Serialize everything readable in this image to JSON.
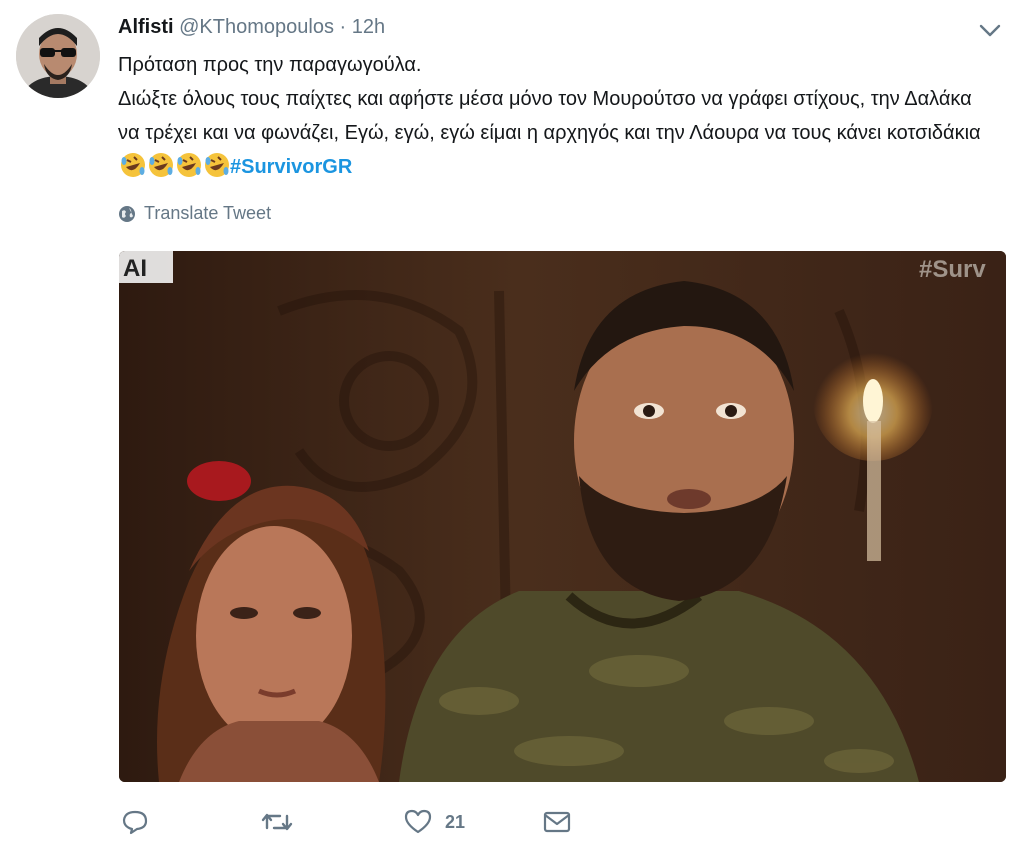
{
  "tweet": {
    "display_name": "Alfisti",
    "handle": "@KThomopoulos",
    "separator": "·",
    "time": "12h",
    "line1": "Πρόταση προς την παραγωγούλα.",
    "line2": "Διώξτε όλους τους παίχτες και αφήστε μέσα μόνο τον Μουρούτσο να γράφει στίχους, την Δαλάκα να τρέχει και να φωνάζει, Εγώ, εγώ, εγώ είμαι η αρχηγός και την Λάουρα να τους κάνει κοτσιδάκια",
    "emoji": [
      "rofl-emoji",
      "rofl-emoji",
      "rofl-emoji",
      "rofl-emoji"
    ],
    "hashtag": "#SurvivorGR",
    "translate_label": "Translate Tweet"
  },
  "media": {
    "channel_logo": "AI",
    "watermark": "#Surv"
  },
  "actions": {
    "reply_icon": "reply-icon",
    "retweet_icon": "retweet-icon",
    "like_icon": "heart-icon",
    "like_count": "21",
    "dm_icon": "envelope-icon"
  },
  "colors": {
    "link": "#1b95e0",
    "secondary": "#657786",
    "text": "#14171a"
  }
}
